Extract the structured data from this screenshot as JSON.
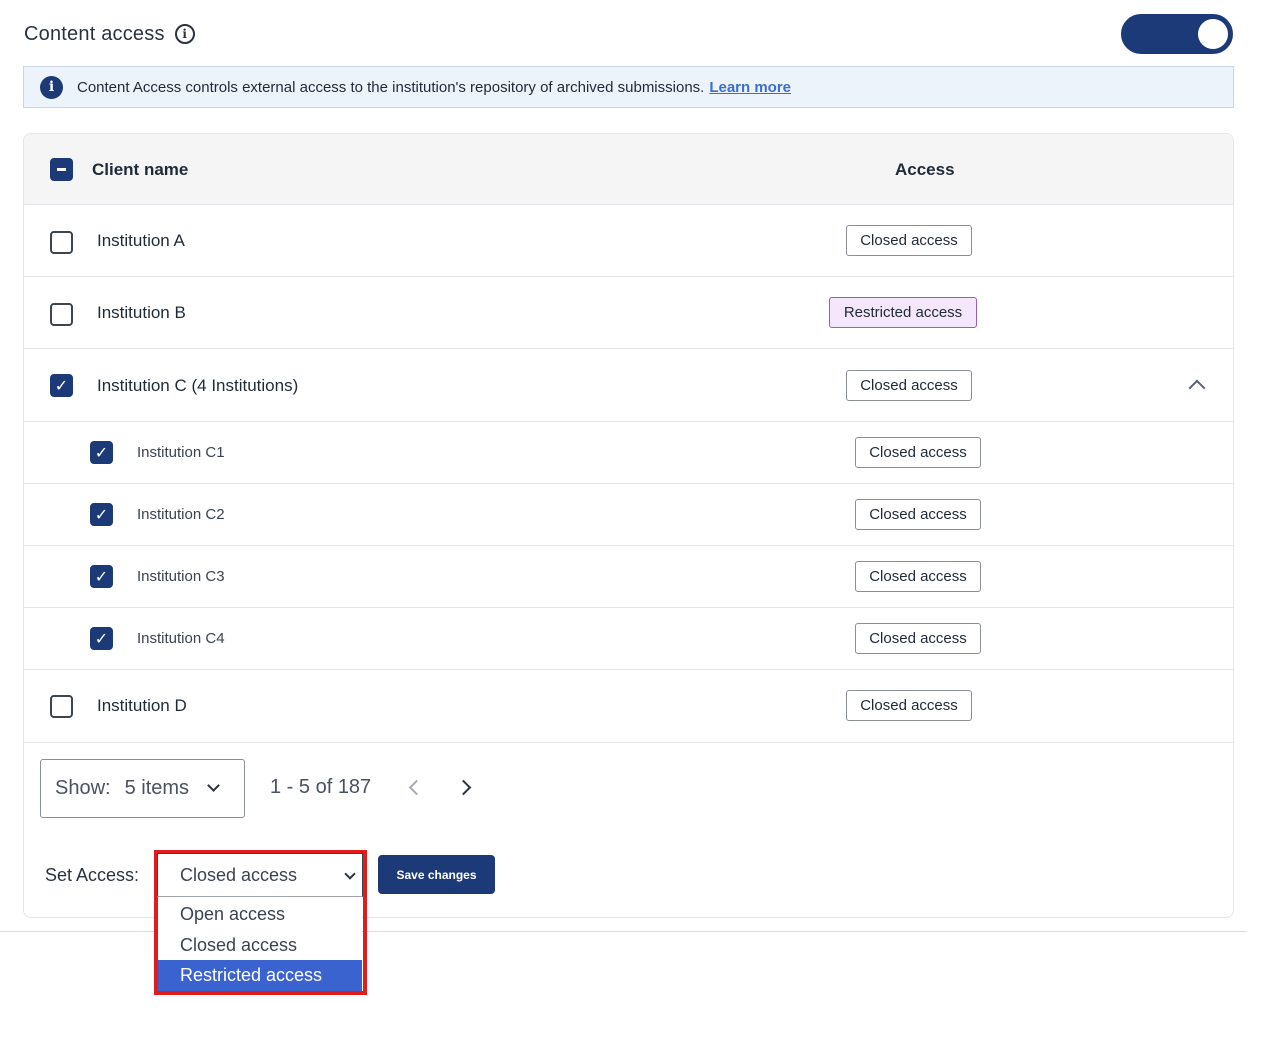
{
  "header": {
    "title": "Content access",
    "info_icon": "info-outline-icon",
    "toggle_on": true
  },
  "banner": {
    "text": "Content Access controls external access to the institution's repository of archived submissions.",
    "link": "Learn more"
  },
  "table": {
    "columns": {
      "name": "Client name",
      "access": "Access"
    },
    "rows": [
      {
        "name": "Institution A",
        "access": "Closed access",
        "checked": false
      },
      {
        "name": "Institution B",
        "access": "Restricted access",
        "checked": false
      },
      {
        "name": "Institution C (4 Institutions)",
        "access": "Closed access",
        "checked": true,
        "expanded": true,
        "children": [
          {
            "name": "Institution C1",
            "access": "Closed access",
            "checked": true
          },
          {
            "name": "Institution C2",
            "access": "Closed access",
            "checked": true
          },
          {
            "name": "Institution C3",
            "access": "Closed access",
            "checked": true
          },
          {
            "name": "Institution C4",
            "access": "Closed access",
            "checked": true
          }
        ]
      },
      {
        "name": "Institution D",
        "access": "Closed access",
        "checked": false
      }
    ]
  },
  "pagination": {
    "show_label": "Show:",
    "show_value": "5 items",
    "range": "1 - 5 of 187"
  },
  "set_access": {
    "label": "Set Access:",
    "selected": "Closed access",
    "options": [
      "Open access",
      "Closed access",
      "Restricted access"
    ],
    "highlighted_option": "Restricted access",
    "save_label": "Save changes"
  }
}
